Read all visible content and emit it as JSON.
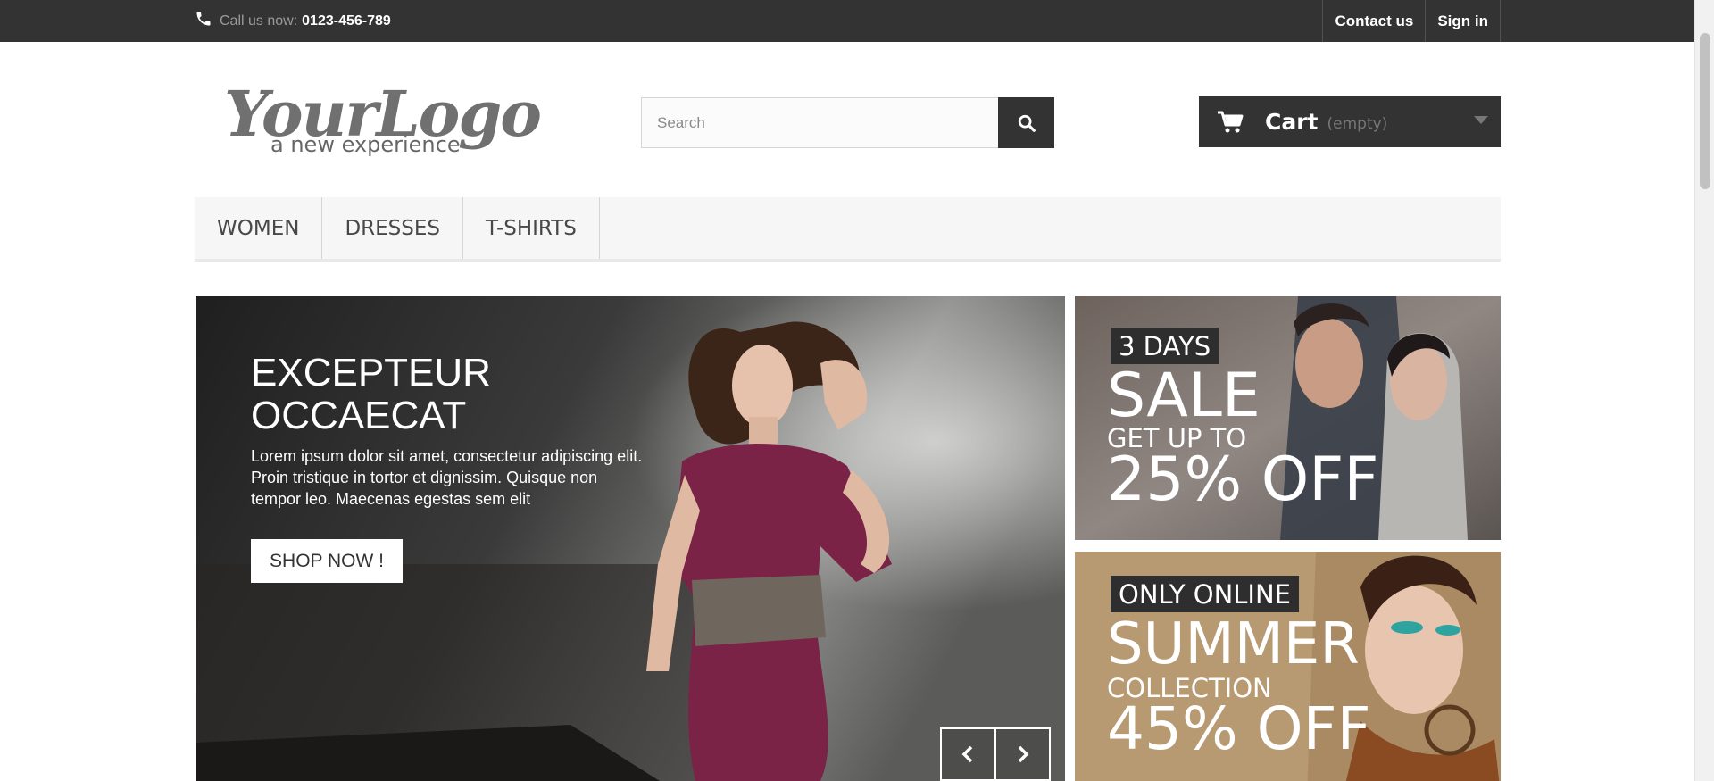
{
  "header": {
    "call_label": "Call us now:",
    "phone_number": "0123-456-789",
    "links": [
      "Contact us",
      "Sign in"
    ]
  },
  "logo": {
    "script": "YourLogo",
    "tagline": "a new experience"
  },
  "search": {
    "placeholder": "Search"
  },
  "cart": {
    "label": "Cart",
    "status": "(empty)"
  },
  "menu": {
    "items": [
      "Women",
      "Dresses",
      "T-shirts"
    ]
  },
  "slider": {
    "title": "EXCEPTEUR OCCAECAT",
    "text": "Lorem ipsum dolor sit amet, consectetur adipiscing elit. Proin tristique in tortor et dignissim. Quisque non tempor leo. Maecenas egestas sem elit",
    "button": "SHOP NOW !"
  },
  "banners": [
    {
      "tag": "3 DAYS",
      "headline": "SALE",
      "subline": "GET UP TO",
      "offer": "25% OFF"
    },
    {
      "tag": "ONLY ONLINE",
      "headline": "SUMMER",
      "subline": "COLLECTION",
      "offer": "45% OFF"
    }
  ],
  "colors": {
    "dark": "#333333",
    "menu_bg": "#f6f6f6",
    "dress": "#7a2346",
    "banner_2_bg": "#b89a72"
  },
  "icons": [
    "phone-icon",
    "search-icon",
    "cart-icon",
    "chevron-left-icon",
    "chevron-right-icon"
  ]
}
